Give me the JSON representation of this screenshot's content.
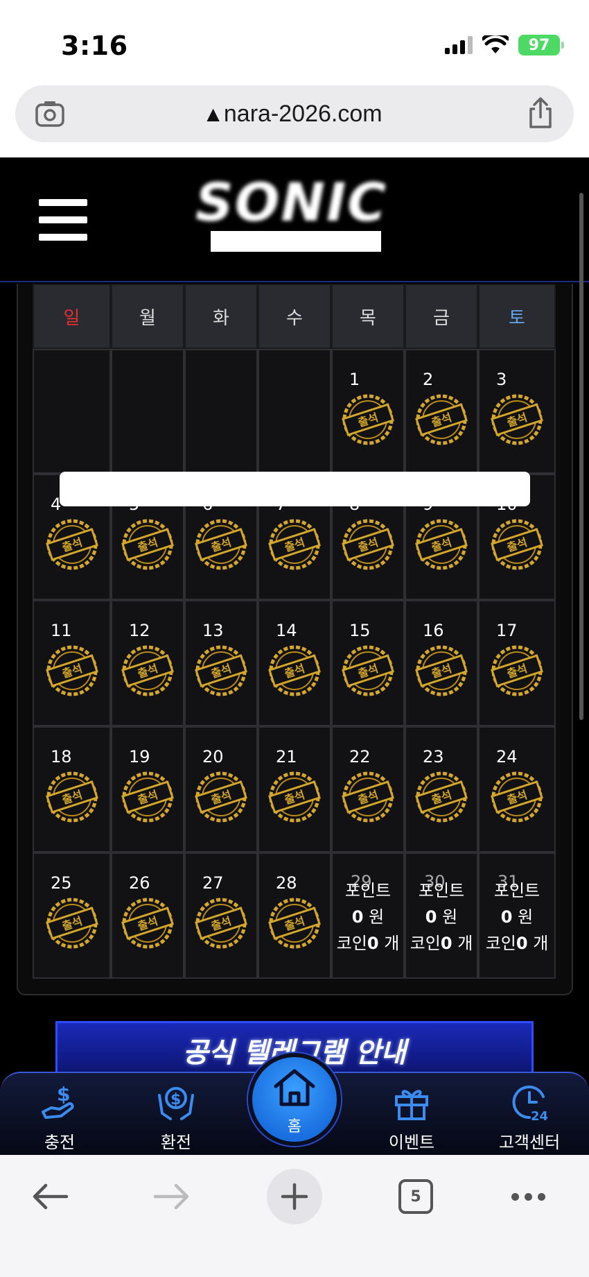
{
  "status_bar": {
    "time": "3:16",
    "battery": "97"
  },
  "browser": {
    "url": "nara-2026.com",
    "tab_count": "5"
  },
  "site": {
    "logo": "SONIC"
  },
  "calendar": {
    "weekdays": [
      "일",
      "월",
      "화",
      "수",
      "목",
      "금",
      "토"
    ],
    "stamp_label": "출석",
    "points_label": "포인트",
    "points_value": "0",
    "points_unit": "원",
    "coin_label": "코인",
    "coin_value": "0",
    "coin_unit": "개",
    "rows": [
      [
        null,
        null,
        null,
        null,
        "1",
        "2",
        "3"
      ],
      [
        "4",
        "5",
        "6",
        "7",
        "8",
        "9",
        "10"
      ],
      [
        "11",
        "12",
        "13",
        "14",
        "15",
        "16",
        "17"
      ],
      [
        "18",
        "19",
        "20",
        "21",
        "22",
        "23",
        "24"
      ],
      [
        "25",
        "26",
        "27",
        "28",
        "29",
        "30",
        "31"
      ]
    ],
    "stamped_until": 28
  },
  "banner": {
    "text": "공식 텔레그램 안내"
  },
  "bottom_nav": {
    "charge": "충전",
    "exchange": "환전",
    "home": "홈",
    "event": "이벤트",
    "support": "고객센터"
  }
}
